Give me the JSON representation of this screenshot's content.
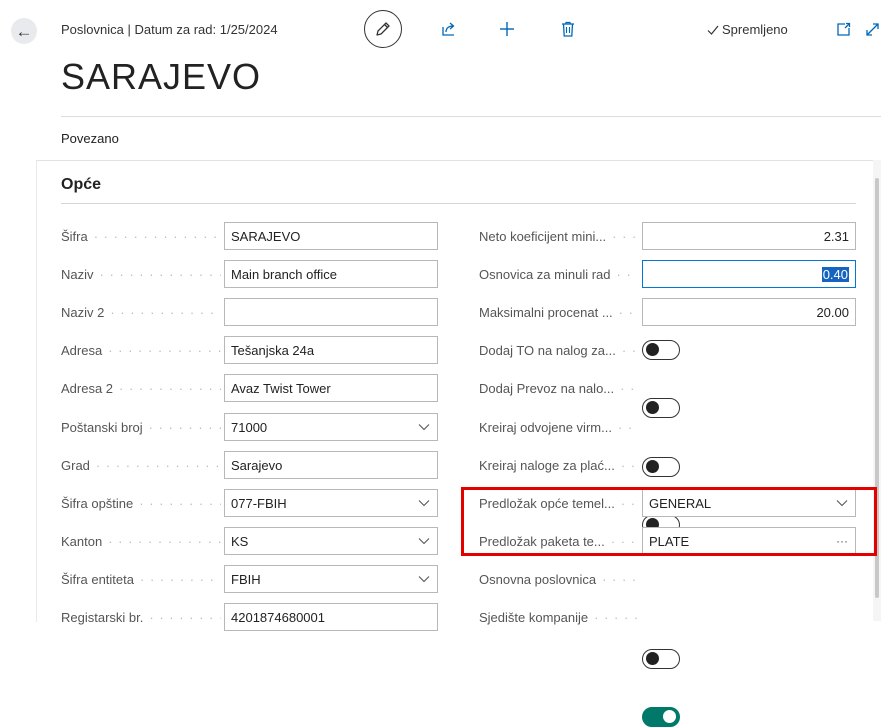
{
  "header": {
    "breadcrumb": "Poslovnica | Datum za rad: 1/25/2024",
    "saved_label": "Spremljeno",
    "title": "SARAJEVO"
  },
  "nav": {
    "related_label": "Povezano"
  },
  "section": {
    "title": "Opće"
  },
  "left_fields": [
    {
      "label": "Šifra",
      "value": "SARAJEVO",
      "type": "text"
    },
    {
      "label": "Naziv",
      "value": "Main branch office",
      "type": "text"
    },
    {
      "label": "Naziv 2",
      "value": "",
      "type": "text"
    },
    {
      "label": "Adresa",
      "value": "Tešanjska 24a",
      "type": "text"
    },
    {
      "label": "Adresa 2",
      "value": "Avaz Twist Tower",
      "type": "text"
    },
    {
      "label": "Poštanski broj",
      "value": "71000",
      "type": "dropdown"
    },
    {
      "label": "Grad",
      "value": "Sarajevo",
      "type": "text"
    },
    {
      "label": "Šifra opštine",
      "value": "077-FBIH",
      "type": "dropdown"
    },
    {
      "label": "Kanton",
      "value": "KS",
      "type": "dropdown"
    },
    {
      "label": "Šifra entiteta",
      "value": "FBIH",
      "type": "dropdown"
    },
    {
      "label": "Registarski br.",
      "value": "4201874680001",
      "type": "text"
    }
  ],
  "right_fields": [
    {
      "label": "Neto koeficijent mini...",
      "value": "2.31",
      "type": "number"
    },
    {
      "label": "Osnovica za minuli rad",
      "value": "0.40",
      "type": "number-focused"
    },
    {
      "label": "Maksimalni procenat ...",
      "value": "20.00",
      "type": "number"
    },
    {
      "label": "Dodaj TO na nalog za...",
      "value": "off",
      "type": "toggle"
    },
    {
      "label": "Dodaj Prevoz na nalo...",
      "value": "off",
      "type": "toggle"
    },
    {
      "label": "Kreiraj odvojene virm...",
      "value": "off",
      "type": "toggle"
    },
    {
      "label": "Kreiraj naloge za plać...",
      "value": "off",
      "type": "toggle"
    },
    {
      "label": "Predložak opće temel...",
      "value": "GENERAL",
      "type": "dropdown"
    },
    {
      "label": "Predložak paketa te...",
      "value": "PLATE",
      "type": "lookup"
    },
    {
      "label": "Osnovna poslovnica",
      "value": "off",
      "type": "toggle"
    },
    {
      "label": "Sjedište kompanije",
      "value": "on",
      "type": "toggle"
    }
  ],
  "colors": {
    "accent": "#0078d4",
    "highlight": "#e50000",
    "toggle_on": "#00796b",
    "selection": "#1565c0"
  },
  "icons": [
    "back-arrow-icon",
    "pencil-icon",
    "share-icon",
    "plus-icon",
    "trash-icon",
    "checkmark-icon",
    "open-in-new-icon",
    "expand-icon",
    "chevron-down-icon",
    "ellipsis-icon"
  ]
}
